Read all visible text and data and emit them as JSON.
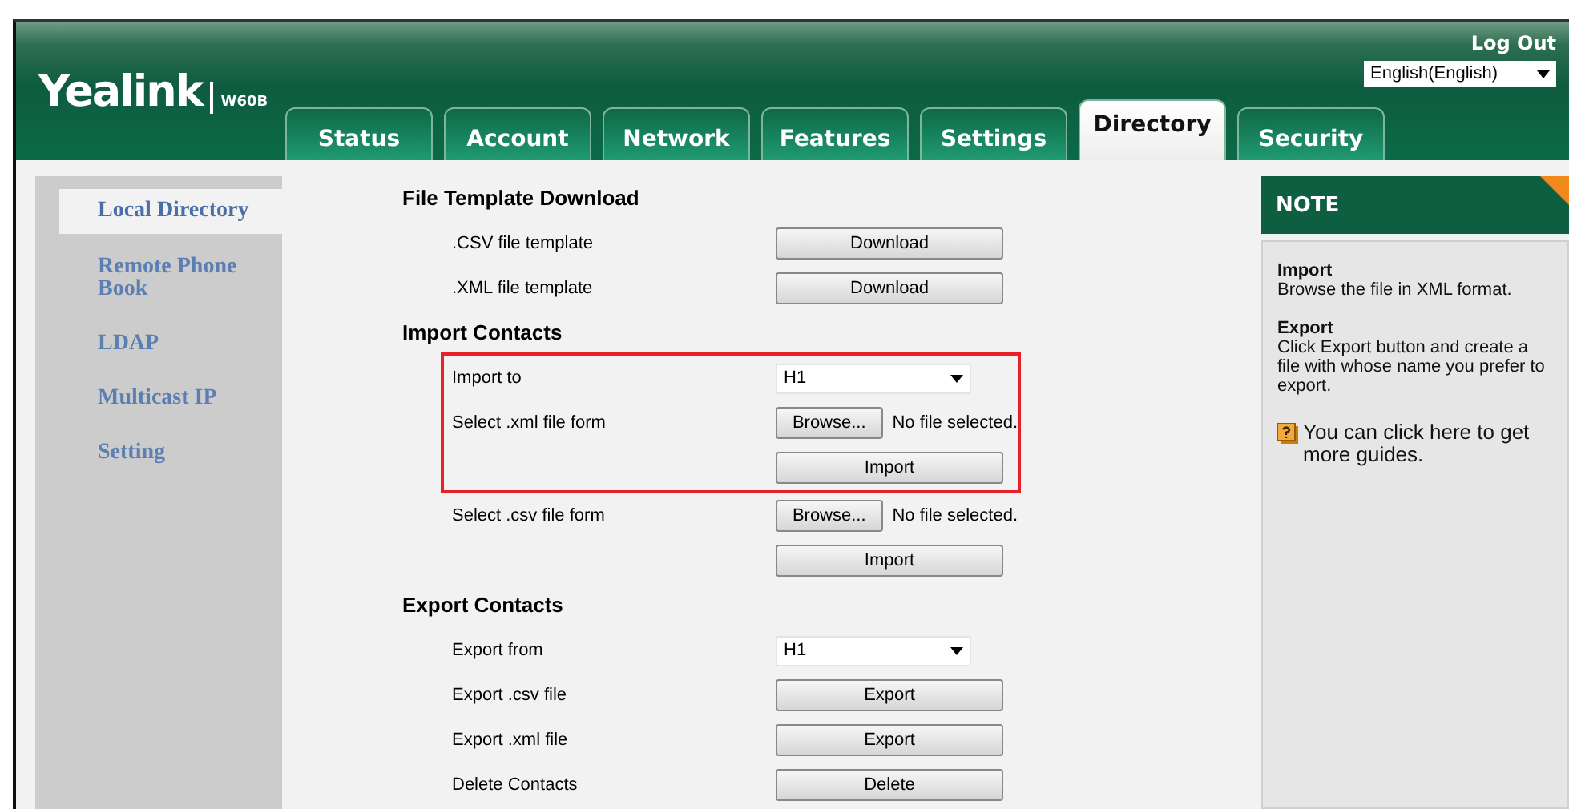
{
  "header": {
    "logo": "Yealink",
    "model": "W60B",
    "logout": "Log Out",
    "language": "English(English)"
  },
  "tabs": [
    {
      "label": "Status",
      "selected": false
    },
    {
      "label": "Account",
      "selected": false
    },
    {
      "label": "Network",
      "selected": false
    },
    {
      "label": "Features",
      "selected": false
    },
    {
      "label": "Settings",
      "selected": false
    },
    {
      "label": "Directory",
      "selected": true
    },
    {
      "label": "Security",
      "selected": false
    }
  ],
  "sidebar": {
    "items": [
      {
        "label": "Local Directory",
        "selected": true
      },
      {
        "label": "Remote Phone Book",
        "selected": false
      },
      {
        "label": "LDAP",
        "selected": false
      },
      {
        "label": "Multicast IP",
        "selected": false
      },
      {
        "label": "Setting",
        "selected": false
      }
    ]
  },
  "sections": [
    {
      "title": "File Template Download",
      "groups": [
        {
          "highlighted": false,
          "rows": [
            {
              "kind": "button",
              "label": ".CSV file template",
              "button": "Download"
            },
            {
              "kind": "button",
              "label": ".XML file template",
              "button": "Download"
            }
          ]
        }
      ]
    },
    {
      "title": "Import Contacts",
      "groups": [
        {
          "highlighted": true,
          "rows": [
            {
              "kind": "select",
              "label": "Import to",
              "value": "H1"
            },
            {
              "kind": "file",
              "label": "Select .xml file form",
              "button": "Browse...",
              "status": "No file selected."
            },
            {
              "kind": "button",
              "button": "Import"
            }
          ]
        },
        {
          "highlighted": false,
          "rows": [
            {
              "kind": "file",
              "label": "Select .csv file form",
              "button": "Browse...",
              "status": "No file selected."
            },
            {
              "kind": "button",
              "button": "Import"
            }
          ]
        }
      ]
    },
    {
      "title": "Export Contacts",
      "groups": [
        {
          "highlighted": false,
          "rows": [
            {
              "kind": "select",
              "label": "Export from",
              "value": "H1"
            },
            {
              "kind": "button",
              "label": "Export .csv file",
              "button": "Export"
            },
            {
              "kind": "button",
              "label": "Export .xml file",
              "button": "Export"
            },
            {
              "kind": "button",
              "label": "Delete Contacts",
              "button": "Delete"
            }
          ]
        }
      ]
    }
  ],
  "note": {
    "title": "NOTE",
    "items": [
      {
        "heading": "Import",
        "text": "Browse the file in XML format."
      },
      {
        "heading": "Export",
        "text": "Click Export button and create a file with whose name you prefer to export."
      }
    ],
    "link": "You can click here to get more guides."
  }
}
